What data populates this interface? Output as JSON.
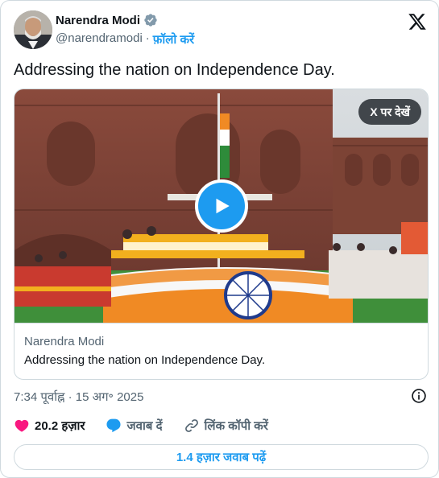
{
  "author": {
    "name": "Narendra Modi",
    "handle": "@narendramodi",
    "separator": "·",
    "follow_label": "फ़ॉलो करें"
  },
  "tweet": {
    "text": "Addressing the nation on Independence Day."
  },
  "media": {
    "view_on_x_label": "X पर देखें",
    "link_domain": "Narendra Modi",
    "link_title": "Addressing the nation on Independence Day."
  },
  "meta": {
    "timestamp": "7:34 पूर्वाह्न · 15 अग॰ 2025"
  },
  "actions": {
    "likes": "20.2 हज़ार",
    "reply_label": "जवाब दें",
    "copy_link_label": "लिंक कॉपी करें"
  },
  "read_replies_label": "1.4 हज़ार जवाब पढ़ें",
  "colors": {
    "accent": "#1d9bf0",
    "like": "#f91880",
    "secondary_text": "#536471"
  },
  "icons": [
    "verified-badge-icon",
    "x-logo-icon",
    "play-icon",
    "info-icon",
    "heart-icon",
    "reply-bubble-icon",
    "link-icon"
  ]
}
